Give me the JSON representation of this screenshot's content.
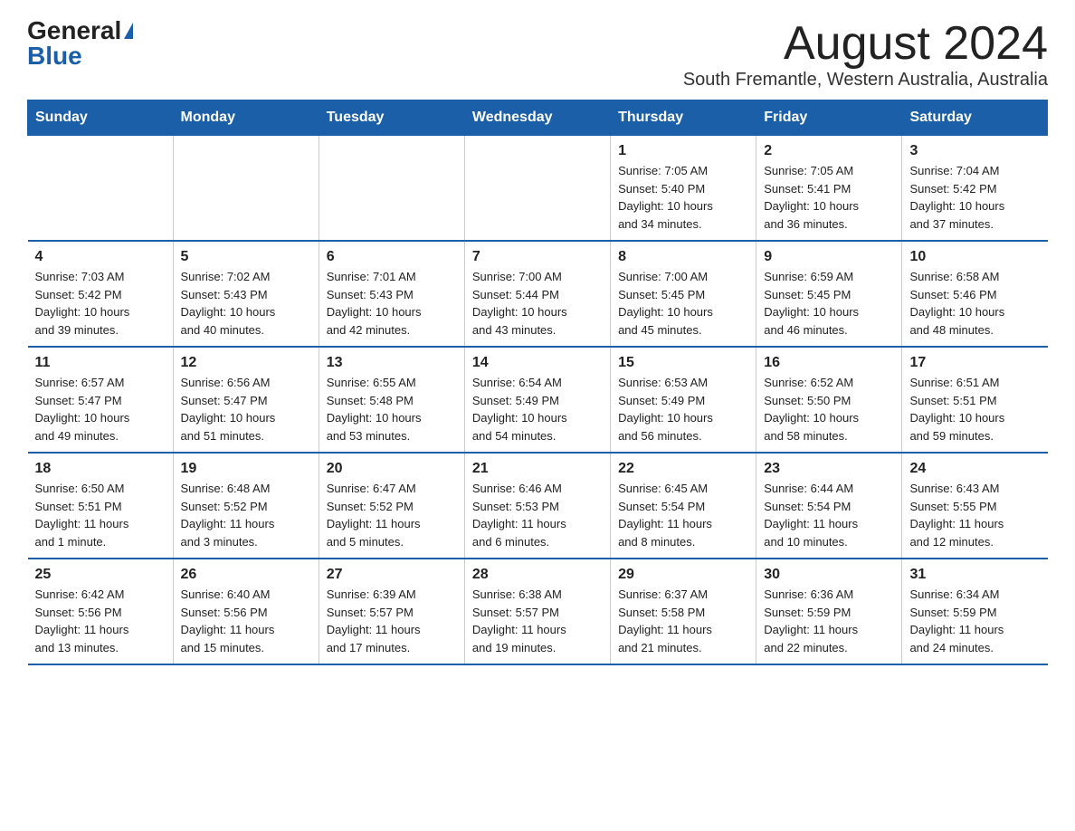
{
  "logo": {
    "general": "General",
    "blue": "Blue"
  },
  "title": "August 2024",
  "subtitle": "South Fremantle, Western Australia, Australia",
  "days_header": [
    "Sunday",
    "Monday",
    "Tuesday",
    "Wednesday",
    "Thursday",
    "Friday",
    "Saturday"
  ],
  "weeks": [
    [
      {
        "day": "",
        "info": ""
      },
      {
        "day": "",
        "info": ""
      },
      {
        "day": "",
        "info": ""
      },
      {
        "day": "",
        "info": ""
      },
      {
        "day": "1",
        "info": "Sunrise: 7:05 AM\nSunset: 5:40 PM\nDaylight: 10 hours\nand 34 minutes."
      },
      {
        "day": "2",
        "info": "Sunrise: 7:05 AM\nSunset: 5:41 PM\nDaylight: 10 hours\nand 36 minutes."
      },
      {
        "day": "3",
        "info": "Sunrise: 7:04 AM\nSunset: 5:42 PM\nDaylight: 10 hours\nand 37 minutes."
      }
    ],
    [
      {
        "day": "4",
        "info": "Sunrise: 7:03 AM\nSunset: 5:42 PM\nDaylight: 10 hours\nand 39 minutes."
      },
      {
        "day": "5",
        "info": "Sunrise: 7:02 AM\nSunset: 5:43 PM\nDaylight: 10 hours\nand 40 minutes."
      },
      {
        "day": "6",
        "info": "Sunrise: 7:01 AM\nSunset: 5:43 PM\nDaylight: 10 hours\nand 42 minutes."
      },
      {
        "day": "7",
        "info": "Sunrise: 7:00 AM\nSunset: 5:44 PM\nDaylight: 10 hours\nand 43 minutes."
      },
      {
        "day": "8",
        "info": "Sunrise: 7:00 AM\nSunset: 5:45 PM\nDaylight: 10 hours\nand 45 minutes."
      },
      {
        "day": "9",
        "info": "Sunrise: 6:59 AM\nSunset: 5:45 PM\nDaylight: 10 hours\nand 46 minutes."
      },
      {
        "day": "10",
        "info": "Sunrise: 6:58 AM\nSunset: 5:46 PM\nDaylight: 10 hours\nand 48 minutes."
      }
    ],
    [
      {
        "day": "11",
        "info": "Sunrise: 6:57 AM\nSunset: 5:47 PM\nDaylight: 10 hours\nand 49 minutes."
      },
      {
        "day": "12",
        "info": "Sunrise: 6:56 AM\nSunset: 5:47 PM\nDaylight: 10 hours\nand 51 minutes."
      },
      {
        "day": "13",
        "info": "Sunrise: 6:55 AM\nSunset: 5:48 PM\nDaylight: 10 hours\nand 53 minutes."
      },
      {
        "day": "14",
        "info": "Sunrise: 6:54 AM\nSunset: 5:49 PM\nDaylight: 10 hours\nand 54 minutes."
      },
      {
        "day": "15",
        "info": "Sunrise: 6:53 AM\nSunset: 5:49 PM\nDaylight: 10 hours\nand 56 minutes."
      },
      {
        "day": "16",
        "info": "Sunrise: 6:52 AM\nSunset: 5:50 PM\nDaylight: 10 hours\nand 58 minutes."
      },
      {
        "day": "17",
        "info": "Sunrise: 6:51 AM\nSunset: 5:51 PM\nDaylight: 10 hours\nand 59 minutes."
      }
    ],
    [
      {
        "day": "18",
        "info": "Sunrise: 6:50 AM\nSunset: 5:51 PM\nDaylight: 11 hours\nand 1 minute."
      },
      {
        "day": "19",
        "info": "Sunrise: 6:48 AM\nSunset: 5:52 PM\nDaylight: 11 hours\nand 3 minutes."
      },
      {
        "day": "20",
        "info": "Sunrise: 6:47 AM\nSunset: 5:52 PM\nDaylight: 11 hours\nand 5 minutes."
      },
      {
        "day": "21",
        "info": "Sunrise: 6:46 AM\nSunset: 5:53 PM\nDaylight: 11 hours\nand 6 minutes."
      },
      {
        "day": "22",
        "info": "Sunrise: 6:45 AM\nSunset: 5:54 PM\nDaylight: 11 hours\nand 8 minutes."
      },
      {
        "day": "23",
        "info": "Sunrise: 6:44 AM\nSunset: 5:54 PM\nDaylight: 11 hours\nand 10 minutes."
      },
      {
        "day": "24",
        "info": "Sunrise: 6:43 AM\nSunset: 5:55 PM\nDaylight: 11 hours\nand 12 minutes."
      }
    ],
    [
      {
        "day": "25",
        "info": "Sunrise: 6:42 AM\nSunset: 5:56 PM\nDaylight: 11 hours\nand 13 minutes."
      },
      {
        "day": "26",
        "info": "Sunrise: 6:40 AM\nSunset: 5:56 PM\nDaylight: 11 hours\nand 15 minutes."
      },
      {
        "day": "27",
        "info": "Sunrise: 6:39 AM\nSunset: 5:57 PM\nDaylight: 11 hours\nand 17 minutes."
      },
      {
        "day": "28",
        "info": "Sunrise: 6:38 AM\nSunset: 5:57 PM\nDaylight: 11 hours\nand 19 minutes."
      },
      {
        "day": "29",
        "info": "Sunrise: 6:37 AM\nSunset: 5:58 PM\nDaylight: 11 hours\nand 21 minutes."
      },
      {
        "day": "30",
        "info": "Sunrise: 6:36 AM\nSunset: 5:59 PM\nDaylight: 11 hours\nand 22 minutes."
      },
      {
        "day": "31",
        "info": "Sunrise: 6:34 AM\nSunset: 5:59 PM\nDaylight: 11 hours\nand 24 minutes."
      }
    ]
  ]
}
